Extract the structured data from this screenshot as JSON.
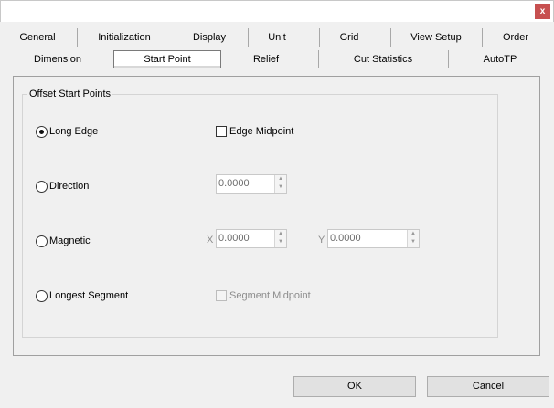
{
  "window": {
    "close_glyph": "x"
  },
  "tabs_row1": [
    "General",
    "Initialization",
    "Display",
    "Unit",
    "Grid",
    "View Setup",
    "Order"
  ],
  "tabs_row2": [
    "Dimension",
    "Start Point",
    "Relief",
    "Cut Statistics",
    "AutoTP"
  ],
  "active_tab": "Start Point",
  "group": {
    "title": "Offset Start Points"
  },
  "options": {
    "long_edge": {
      "label": "Long Edge",
      "selected": true
    },
    "edge_midpoint": {
      "label": "Edge Midpoint",
      "checked": false
    },
    "direction": {
      "label": "Direction",
      "selected": false,
      "value": "0.0000"
    },
    "magnetic": {
      "label": "Magnetic",
      "selected": false,
      "x_label": "X",
      "x_value": "0.0000",
      "y_label": "Y",
      "y_value": "0.0000"
    },
    "longest_segment": {
      "label": "Longest Segment",
      "selected": false
    },
    "segment_midpoint": {
      "label": "Segment Midpoint",
      "checked": false,
      "disabled": true
    }
  },
  "buttons": {
    "ok": "OK",
    "cancel": "Cancel"
  },
  "colors": {
    "close_red": "#c75050",
    "background": "#f0f0f0",
    "disabled_text": "#8c8c8c"
  }
}
